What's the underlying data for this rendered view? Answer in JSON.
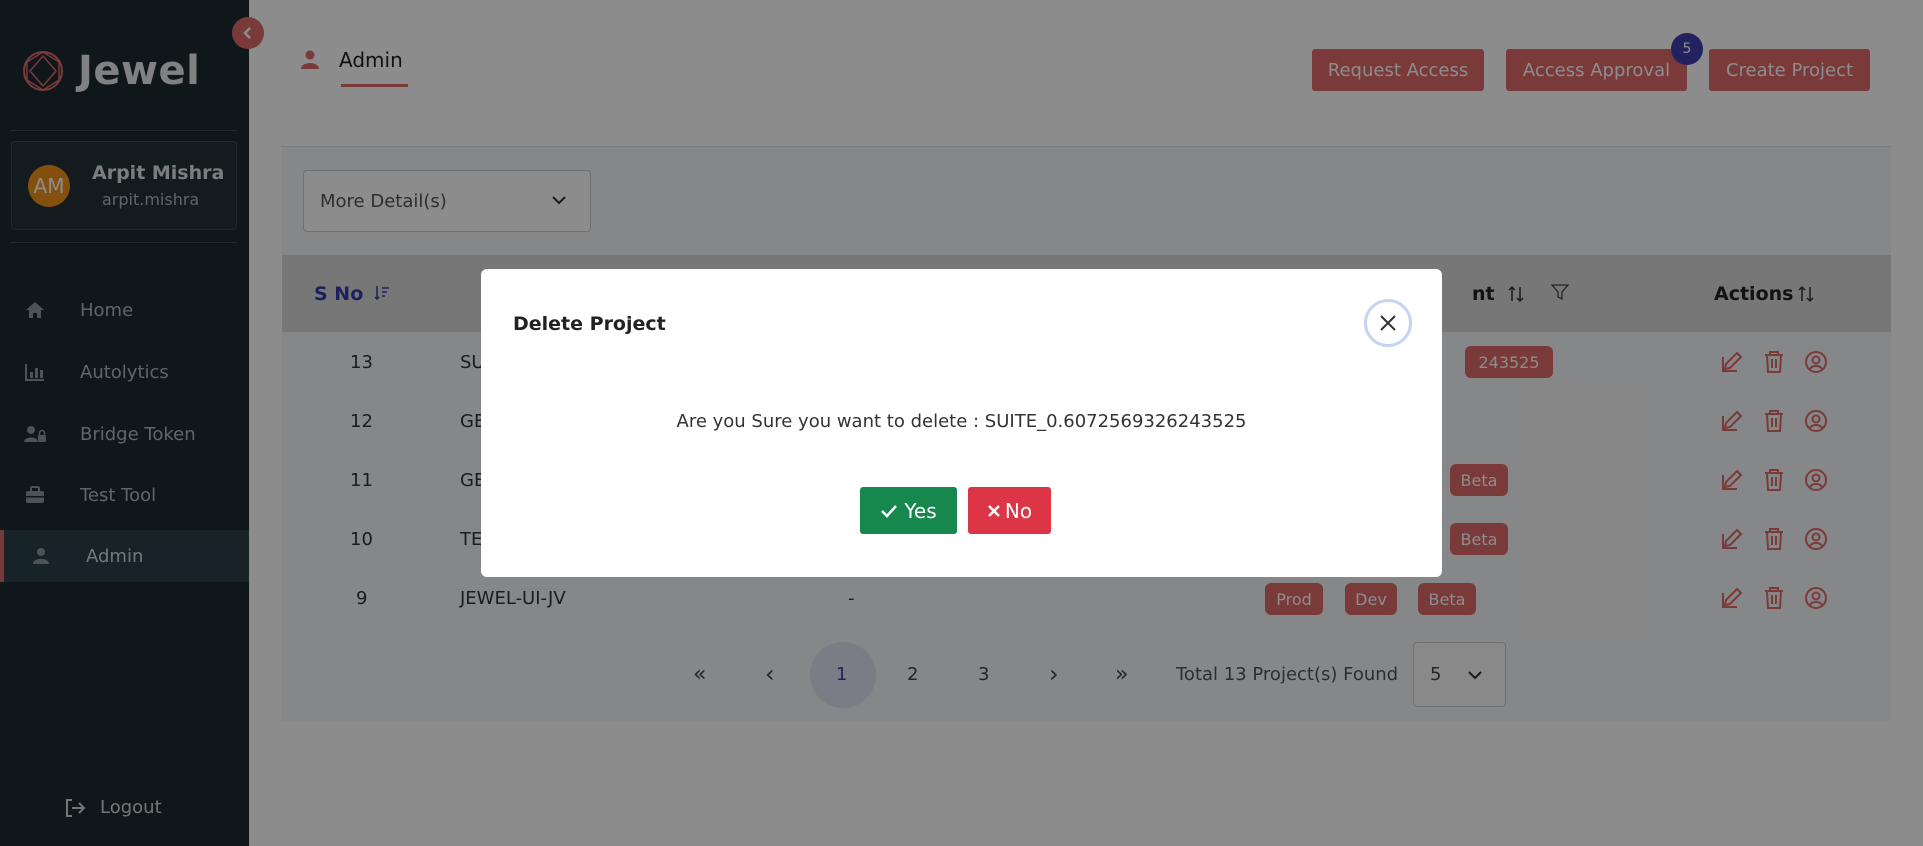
{
  "sidebar": {
    "brand": "Jewel",
    "profile": {
      "initials": "AM",
      "name": "Arpit Mishra",
      "username": "arpit.mishra"
    },
    "nav": [
      {
        "label": "Home",
        "icon": "home-icon"
      },
      {
        "label": "Autolytics",
        "icon": "bar-chart-icon"
      },
      {
        "label": "Bridge Token",
        "icon": "user-lock-icon"
      },
      {
        "label": "Test Tool",
        "icon": "toolbox-icon"
      },
      {
        "label": "Admin",
        "icon": "user-icon",
        "active": true
      }
    ],
    "logout": "Logout"
  },
  "header": {
    "tab": "Admin",
    "buttons": {
      "request_access": "Request Access",
      "access_approval": "Access Approval",
      "create_project": "Create Project"
    },
    "approval_badge": "5"
  },
  "filter": {
    "more_details": "More Detail(s)"
  },
  "table": {
    "headers": {
      "sno": "S No",
      "environment_suffix": "nt",
      "actions": "Actions"
    },
    "rows": [
      {
        "sno": "13",
        "name": "SU",
        "desc": "",
        "tags": [
          "243525"
        ]
      },
      {
        "sno": "12",
        "name": "GE",
        "desc": "",
        "tags": []
      },
      {
        "sno": "11",
        "name": "GE",
        "desc": "",
        "tags": [
          "Beta"
        ]
      },
      {
        "sno": "10",
        "name": "TE",
        "desc": "",
        "tags": [
          "Beta"
        ]
      },
      {
        "sno": "9",
        "name": "JEWEL-UI-JV",
        "desc": "-",
        "tags": [
          "Prod",
          "Dev",
          "Beta"
        ]
      }
    ]
  },
  "pagination": {
    "first": "«",
    "prev": "‹",
    "pages": [
      "1",
      "2",
      "3"
    ],
    "next": "›",
    "last": "»",
    "total_text": "Total 13 Project(s) Found",
    "page_size": "5"
  },
  "modal": {
    "title": "Delete Project",
    "message": "Are you Sure you want to delete : SUITE_0.6072569326243525",
    "yes": "Yes",
    "no": "No"
  },
  "colors": {
    "accent": "#e06b6b",
    "sidebar": "#1e2a30",
    "yes": "#16884d",
    "no": "#dc3545",
    "badge": "#3f3fb0"
  }
}
